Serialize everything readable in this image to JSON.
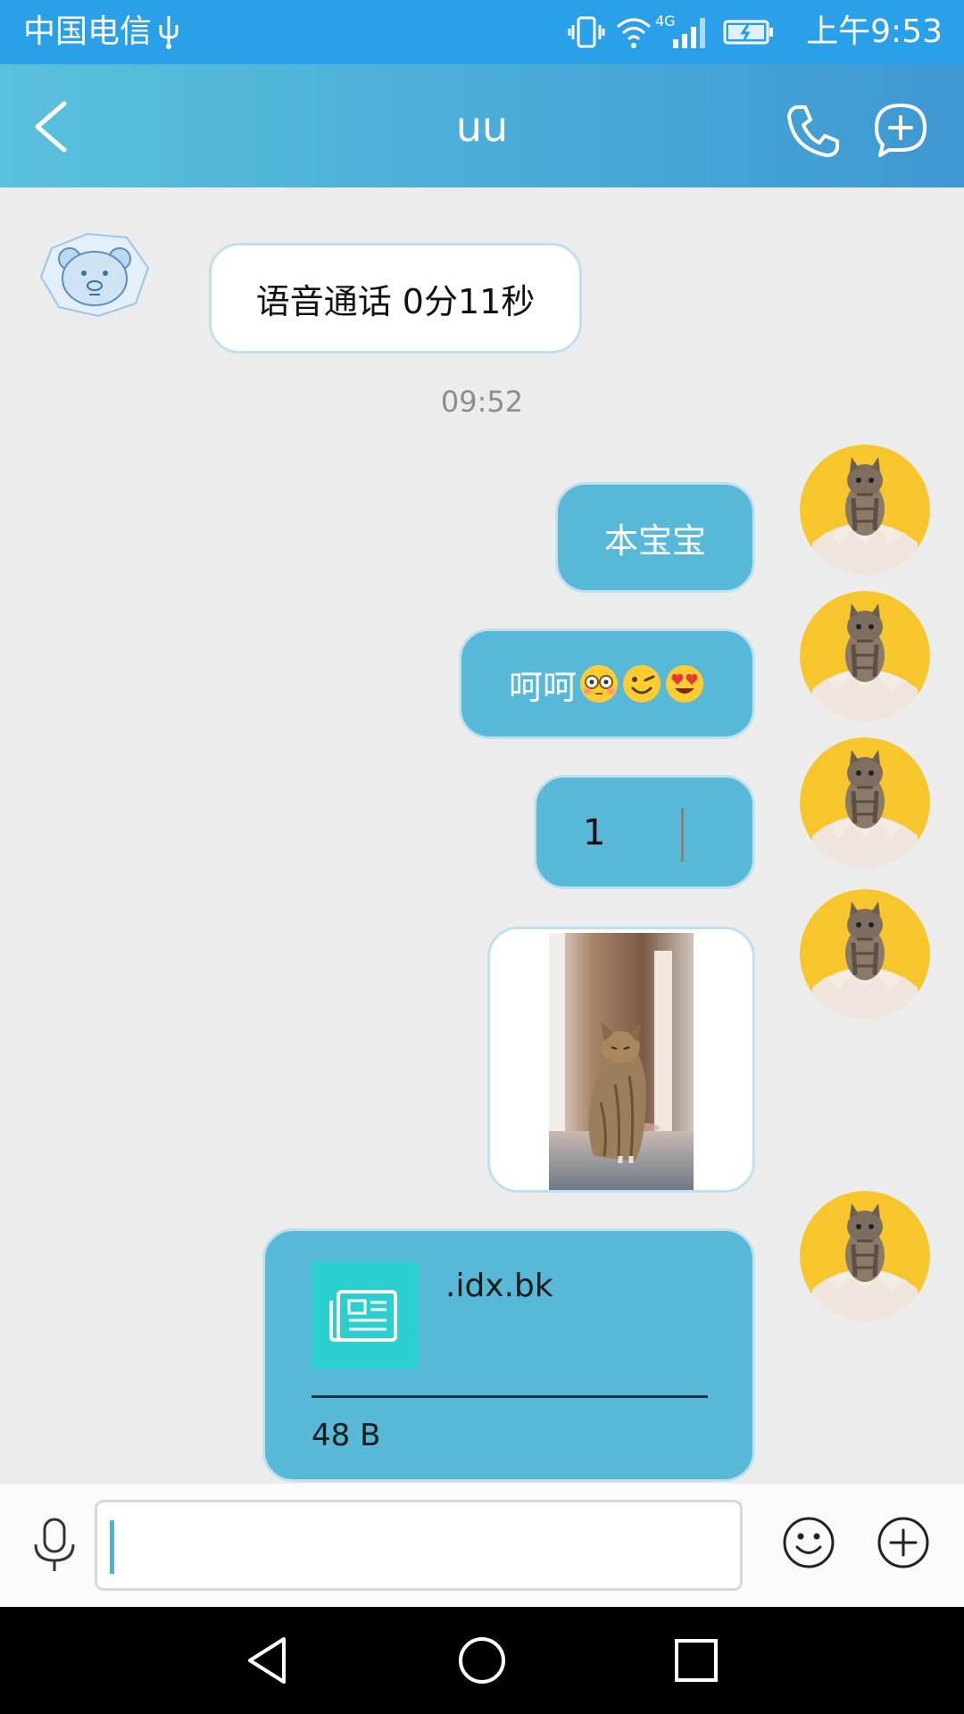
{
  "status_bar": {
    "carrier": "中国电信",
    "network": "4G",
    "time": "上午9:53"
  },
  "header": {
    "title": "uu",
    "icons": [
      "back-arrow-icon",
      "phone-icon",
      "chat-add-icon"
    ]
  },
  "messages": [
    {
      "from": "contact",
      "type": "text",
      "text": "语音通话 0分11秒"
    },
    {
      "type": "timestamp",
      "text": "09:52"
    },
    {
      "from": "me",
      "type": "text",
      "text": "本宝宝"
    },
    {
      "from": "me",
      "type": "text",
      "text": "呵呵",
      "emojis": [
        "flushed-face",
        "winking-face",
        "heart-eyes-face"
      ]
    },
    {
      "from": "me",
      "type": "text",
      "text": "1"
    },
    {
      "from": "me",
      "type": "image",
      "subject": "cat photo"
    },
    {
      "from": "me",
      "type": "file",
      "file_name": ".idx.bk",
      "file_size": "48 B"
    }
  ],
  "input_bar": {
    "value": "",
    "icons": [
      "microphone-icon",
      "emoji-icon",
      "plus-icon"
    ]
  },
  "nav_bar": {
    "icons": [
      "back-triangle-icon",
      "home-circle-icon",
      "recents-square-icon"
    ]
  },
  "colors": {
    "status_bar": "#2aa0e8",
    "header_start": "#5bc0dc",
    "header_end": "#3e98d2",
    "outgoing_bubble": "#57b8d8",
    "incoming_bubble": "#ffffff",
    "file_icon_bg": "#2ccfcf",
    "background": "#ececec"
  }
}
